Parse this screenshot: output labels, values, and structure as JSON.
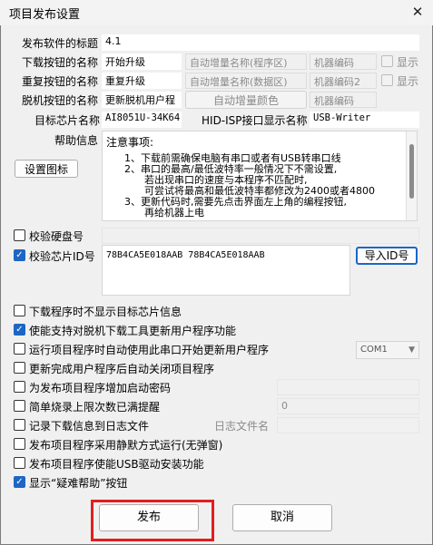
{
  "window": {
    "title": "项目发布设置",
    "close_glyph": "✕"
  },
  "rows": {
    "publish_title_label": "发布软件的标题",
    "publish_title_value": "4.1",
    "download_btn_label": "下载按钮的名称",
    "download_btn_value": "开始升级",
    "auto_inc_program": "自动增量名称(程序区)",
    "machine_code_1": "机器编码",
    "show_label_1": "显示",
    "repeat_btn_label": "重复按钮的名称",
    "repeat_btn_value": "重复升级",
    "auto_inc_data": "自动增量名称(数据区)",
    "machine_code_2": "机器编码2",
    "show_label_2": "显示",
    "offline_btn_label": "脱机按钮的名称",
    "offline_btn_value": "更新脱机用户程",
    "auto_inc_color": "自动增量颜色",
    "machine_code_3": "机器编码",
    "target_chip_label": "目标芯片名称",
    "target_chip_value": "AI8051U-34K64",
    "hid_label": "HID-ISP接口显示名称",
    "hid_value": "USB-Writer",
    "help_label": "帮助信息",
    "set_icon_button": "设置图标"
  },
  "notes": {
    "heading": "注意事项:",
    "lines": [
      "1、下载前需确保电脑有串口或者有USB转串口线",
      "2、串口的最高/最低波特率一般情况下不需设置,",
      "若出现串口的速度与本程序不匹配时,",
      "可尝试将最高和最低波特率都修改为2400或者4800",
      "3、更新代码时,需要先点击界面左上角的编程按钮,",
      "再给机器上电"
    ]
  },
  "verify": {
    "disk_label": "校验硬盘号",
    "chip_id_label": "校验芯片ID号",
    "chip_id_value": "78B4CA5E018AAB 78B4CA5E018AAB",
    "import_button": "导入ID号"
  },
  "options": [
    {
      "label": "下载程序时不显示目标芯片信息",
      "checked": false
    },
    {
      "label": "使能支持对脱机下载工具更新用户程序功能",
      "checked": true
    },
    {
      "label": "运行项目程序时自动使用此串口开始更新用户程序",
      "checked": false
    },
    {
      "label": "更新完成用户程序后自动关闭项目程序",
      "checked": false
    },
    {
      "label": "为发布项目程序增加启动密码",
      "checked": false
    },
    {
      "label": "简单烧录上限次数已满提醒",
      "checked": false
    },
    {
      "label": "记录下载信息到日志文件",
      "checked": false
    },
    {
      "label": "发布项目程序采用静默方式运行(无弹窗)",
      "checked": false
    },
    {
      "label": "发布项目程序使能USB驱动安装功能",
      "checked": false
    },
    {
      "label": "显示“疑难帮助”按钮",
      "checked": true
    }
  ],
  "extras": {
    "com_port": "COM1",
    "count_value": "0",
    "log_file_label": "日志文件名"
  },
  "footer": {
    "publish_button": "发布",
    "cancel_button": "取消"
  },
  "colors": {
    "check_blue": "#1d66c4",
    "highlight_red": "#e21e1e"
  }
}
